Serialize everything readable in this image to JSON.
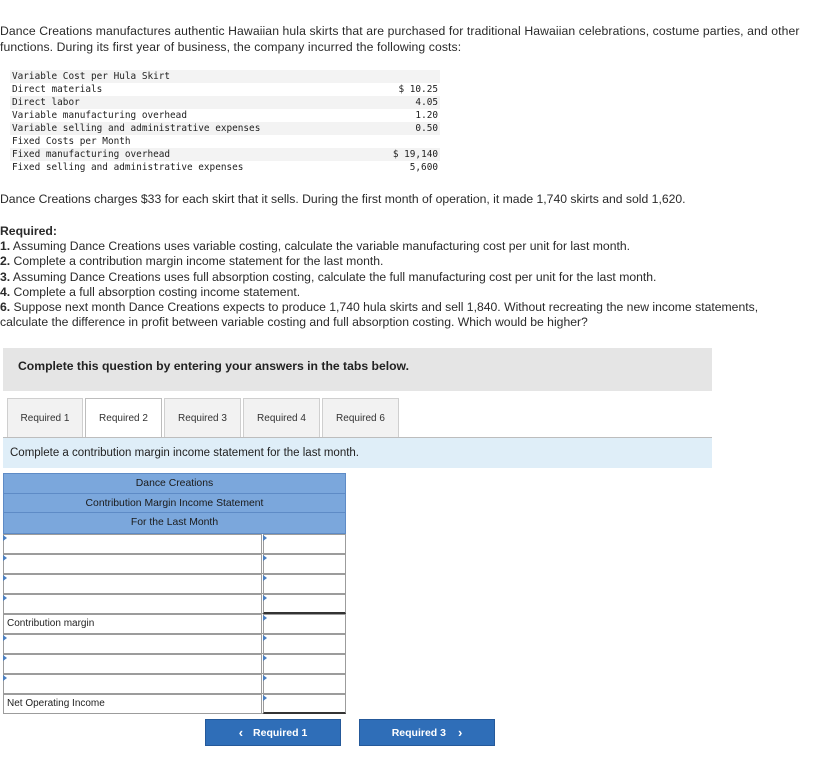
{
  "intro": "Dance Creations manufactures authentic Hawaiian hula skirts that are purchased for traditional Hawaiian celebrations, costume parties, and other functions. During its first year of business, the company incurred the following costs:",
  "cost_table": {
    "rows": [
      {
        "label": "Variable Cost per Hula Skirt",
        "value": ""
      },
      {
        "label": "Direct materials",
        "value": "$ 10.25"
      },
      {
        "label": "Direct labor",
        "value": "4.05"
      },
      {
        "label": "Variable manufacturing overhead",
        "value": "1.20"
      },
      {
        "label": "Variable selling and administrative expenses",
        "value": "0.50"
      },
      {
        "label": "Fixed Costs per Month",
        "value": ""
      },
      {
        "label": "Fixed manufacturing overhead",
        "value": "$ 19,140"
      },
      {
        "label": "Fixed selling and administrative expenses",
        "value": "5,600"
      }
    ]
  },
  "charges_text": "Dance Creations charges $33 for each skirt that it sells. During the first month of operation, it made 1,740 skirts and sold 1,620.",
  "required": {
    "heading": "Required:",
    "items": [
      {
        "num": "1.",
        "text": " Assuming Dance Creations uses variable costing, calculate the variable manufacturing cost per unit for last month."
      },
      {
        "num": "2.",
        "text": " Complete a contribution margin income statement for the last month."
      },
      {
        "num": "3.",
        "text": " Assuming Dance Creations uses full absorption costing, calculate the full manufacturing cost per unit for the last month."
      },
      {
        "num": "4.",
        "text": " Complete a full absorption costing income statement."
      },
      {
        "num": "6.",
        "text": " Suppose next month Dance Creations expects to produce 1,740 hula skirts and sell 1,840. Without recreating the new income statements, calculate the difference in profit between variable costing and full absorption costing. Which would be higher?"
      }
    ]
  },
  "banner_text": "Complete this question by entering your answers in the tabs below.",
  "tabs": [
    {
      "label": "Required 1",
      "active": false
    },
    {
      "label": "Required 2",
      "active": true
    },
    {
      "label": "Required 3",
      "active": false
    },
    {
      "label": "Required 4",
      "active": false
    },
    {
      "label": "Required 6",
      "active": false
    }
  ],
  "instruction": "Complete a contribution margin income statement for the last month.",
  "statement": {
    "company": "Dance Creations",
    "title": "Contribution Margin Income Statement",
    "period": "For the Last Month",
    "rows": [
      {
        "label": "",
        "amount": "",
        "flag": true
      },
      {
        "label": "",
        "amount": "",
        "flag": true
      },
      {
        "label": "",
        "amount": "",
        "flag": true
      },
      {
        "label": "",
        "amount": "",
        "flag": true
      },
      {
        "label": "Contribution margin",
        "amount": "",
        "flag": false
      },
      {
        "label": "",
        "amount": "",
        "flag": true
      },
      {
        "label": "",
        "amount": "",
        "flag": true
      },
      {
        "label": "",
        "amount": "",
        "flag": true
      },
      {
        "label": "Net Operating Income",
        "amount": "",
        "flag": false
      }
    ]
  },
  "nav": {
    "prev_label": "Required 1",
    "next_label": "Required 3",
    "prev_chevron": "‹",
    "next_chevron": "›"
  },
  "colors": {
    "header_blue": "#7ba7dc",
    "button_blue": "#2f6eb8",
    "instruction_bg": "#dfeef8",
    "banner_bg": "#e5e5e5"
  }
}
